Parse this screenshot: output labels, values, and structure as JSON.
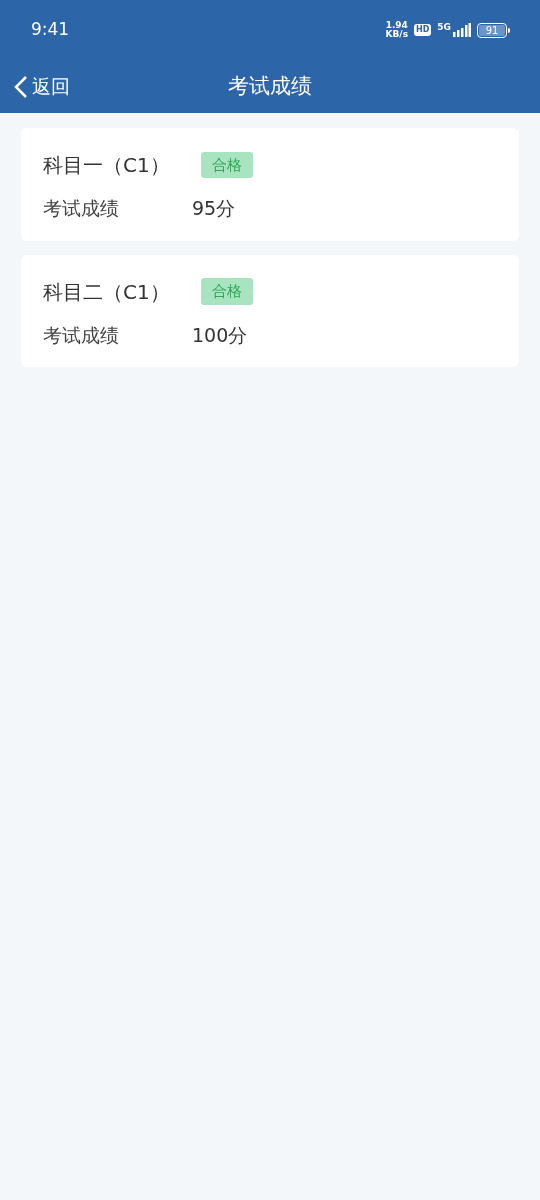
{
  "status_bar": {
    "time": "9:41",
    "net_speed": "1.94",
    "net_unit": "KB/s",
    "hd": "HD",
    "network": "5G",
    "battery": "91"
  },
  "header": {
    "back": "返回",
    "title": "考试成绩"
  },
  "results": [
    {
      "subject": "科目一（C1）",
      "tag": {
        "label": "合格",
        "kind": "pass"
      },
      "label": "考试成绩",
      "score": "95分"
    },
    {
      "subject": "科目二（C1）",
      "tag": {
        "label": "合格",
        "kind": "pass"
      },
      "label": "考试成绩",
      "score": "100分"
    }
  ]
}
